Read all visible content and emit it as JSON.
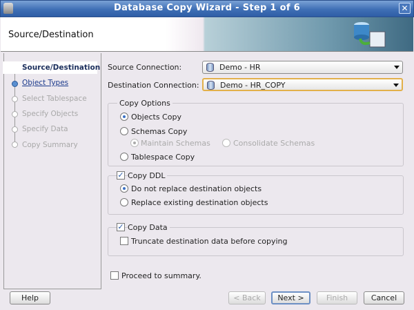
{
  "window": {
    "title": "Database Copy Wizard - Step 1 of 6",
    "close_icon": "close-icon"
  },
  "header": {
    "title": "Source/Destination"
  },
  "steps": [
    {
      "label": "Source/Destination",
      "state": "current"
    },
    {
      "label": "Object Types",
      "state": "link"
    },
    {
      "label": "Select Tablespace",
      "state": "disabled"
    },
    {
      "label": "Specify Objects",
      "state": "disabled"
    },
    {
      "label": "Specify Data",
      "state": "disabled"
    },
    {
      "label": "Copy Summary",
      "state": "disabled"
    }
  ],
  "form": {
    "source_label": "Source Connection:",
    "source_value": "Demo - HR",
    "dest_label": "Destination Connection:",
    "dest_value": "Demo - HR_COPY",
    "copy_options": {
      "title": "Copy Options",
      "objects": "Objects Copy",
      "schemas": "Schemas Copy",
      "maintain": "Maintain Schemas",
      "consolidate": "Consolidate Schemas",
      "tablespace": "Tablespace Copy",
      "selected": "Objects Copy"
    },
    "copy_ddl": {
      "label": "Copy DDL",
      "checked": true,
      "no_replace": "Do not replace destination objects",
      "replace": "Replace existing destination objects",
      "selected": "Do not replace destination objects"
    },
    "copy_data": {
      "label": "Copy Data",
      "checked": true,
      "truncate": "Truncate destination data before copying",
      "truncate_checked": false
    },
    "proceed": {
      "label": "Proceed to summary.",
      "checked": false
    }
  },
  "buttons": {
    "help": "Help",
    "back": "< Back",
    "next": "Next >",
    "finish": "Finish",
    "cancel": "Cancel"
  }
}
